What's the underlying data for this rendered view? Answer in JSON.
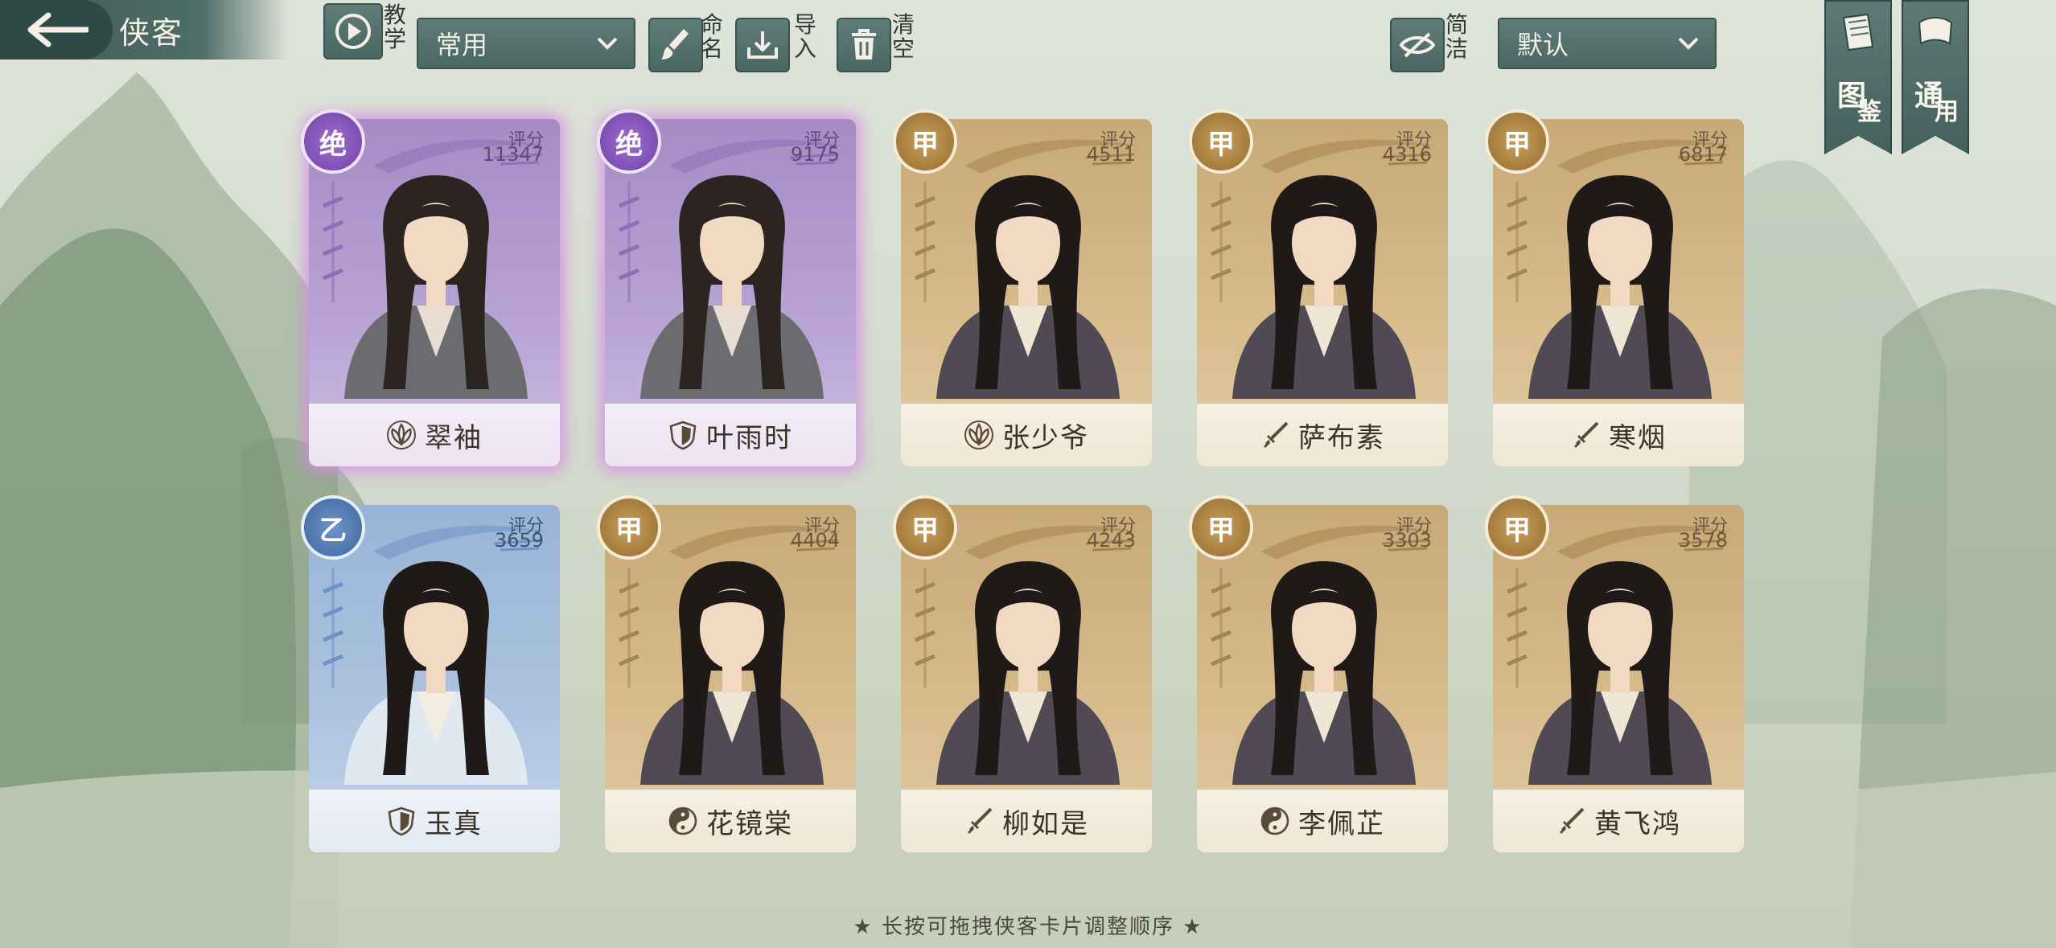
{
  "header": {
    "back_icon": "arrow-left-icon",
    "title": "侠客",
    "tutorial_label": "教学",
    "filter_select": "常用",
    "rename_label": "命名",
    "import_label": "导入",
    "clear_label": "清空",
    "simple_label": "简洁",
    "sort_select": "默认"
  },
  "ribbons": [
    {
      "label_top": "图",
      "label_bottom": "鉴"
    },
    {
      "label_top": "通",
      "label_bottom": "用"
    }
  ],
  "cards": [
    {
      "name": "翠袖",
      "rank": "绝",
      "score_label": "评分",
      "score": "11347",
      "style": "purple",
      "sect_icon": "lotus-icon"
    },
    {
      "name": "叶雨时",
      "rank": "绝",
      "score_label": "评分",
      "score": "9175",
      "style": "purple",
      "sect_icon": "shield-icon"
    },
    {
      "name": "张少爷",
      "rank": "甲",
      "score_label": "评分",
      "score": "4511",
      "style": "tan",
      "sect_icon": "lotus-icon"
    },
    {
      "name": "萨布素",
      "rank": "甲",
      "score_label": "评分",
      "score": "4316",
      "style": "tan",
      "sect_icon": "sword-icon"
    },
    {
      "name": "寒烟",
      "rank": "甲",
      "score_label": "评分",
      "score": "6817",
      "style": "tan",
      "sect_icon": "sword-icon"
    },
    {
      "name": "玉真",
      "rank": "乙",
      "score_label": "评分",
      "score": "3659",
      "style": "blue",
      "sect_icon": "shield-icon"
    },
    {
      "name": "花镜棠",
      "rank": "甲",
      "score_label": "评分",
      "score": "4404",
      "style": "tan",
      "sect_icon": "yin-yang-icon"
    },
    {
      "name": "柳如是",
      "rank": "甲",
      "score_label": "评分",
      "score": "4243",
      "style": "tan",
      "sect_icon": "sword-icon"
    },
    {
      "name": "李佩芷",
      "rank": "甲",
      "score_label": "评分",
      "score": "3303",
      "style": "tan",
      "sect_icon": "yin-yang-icon"
    },
    {
      "name": "黄飞鸿",
      "rank": "甲",
      "score_label": "评分",
      "score": "3578",
      "style": "tan",
      "sect_icon": "sword-icon"
    }
  ],
  "footer": {
    "hint": "★ 长按可拖拽侠客卡片调整顺序 ★"
  },
  "colors": {
    "ui_green": "#4f6d69",
    "purple_rare": "#7f4fb6",
    "tan_rank": "#a57b3c",
    "blue_rank": "#4c74ad"
  }
}
